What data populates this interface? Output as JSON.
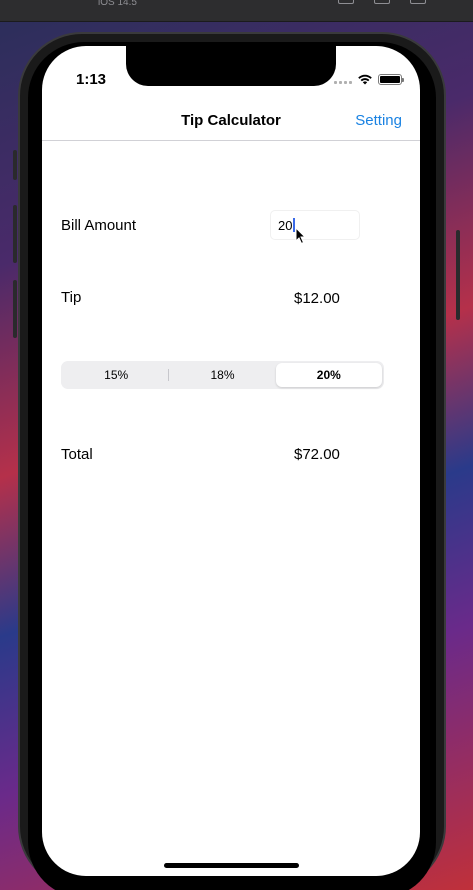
{
  "simulator": {
    "os_label": "iOS 14.5"
  },
  "status_bar": {
    "time": "1:13"
  },
  "nav": {
    "title": "Tip Calculator",
    "right_button": "Setting"
  },
  "bill": {
    "label": "Bill Amount",
    "value": "20"
  },
  "tip": {
    "label": "Tip",
    "value": "$12.00"
  },
  "tip_options": {
    "segments": [
      "15%",
      "18%",
      "20%"
    ],
    "selected": "20%"
  },
  "total": {
    "label": "Total",
    "value": "$72.00"
  },
  "colors": {
    "accent": "#1a82e2",
    "caret": "#3b6be8"
  },
  "icons": [
    "signal-icon",
    "wifi-icon",
    "battery-icon",
    "cursor-icon"
  ]
}
